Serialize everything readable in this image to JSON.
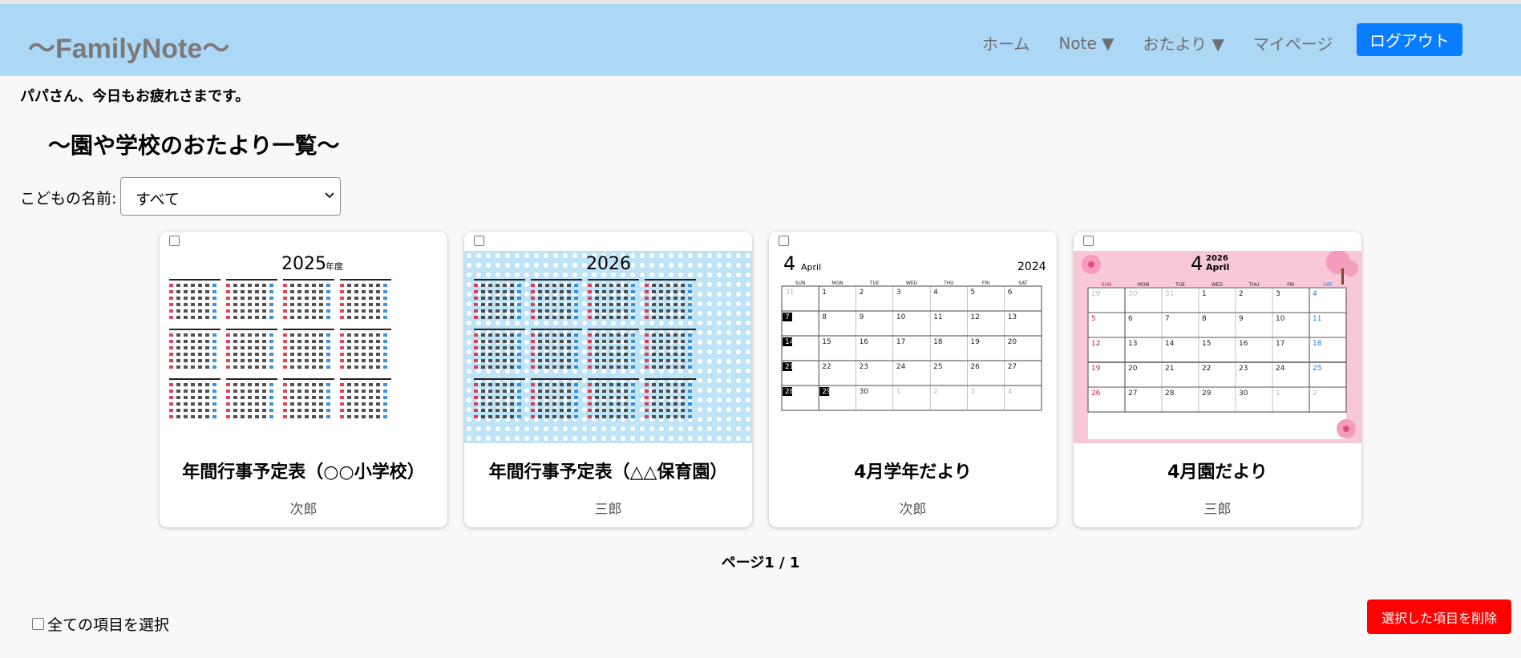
{
  "header": {
    "logo": "〜FamilyNote〜",
    "nav": [
      "ホーム",
      "Note ▼",
      "おたより ▼",
      "マイページ"
    ],
    "logout_label": "ログアウト"
  },
  "greeting": "パパさん、今日もお疲れさまです。",
  "page_title": "〜園や学校のおたより一覧〜",
  "filter": {
    "label": "こどもの名前:",
    "selected": "すべて"
  },
  "cards": [
    {
      "title": "年間行事予定表（○○小学校）",
      "child": "次郎",
      "thumb_heading": "2025",
      "thumb_suffix": "年度"
    },
    {
      "title": "年間行事予定表（△△保育園）",
      "child": "三郎",
      "thumb_heading": "2026"
    },
    {
      "title": "4月学年だより",
      "child": "次郎",
      "month": "4",
      "month_name": "April",
      "year": "2024",
      "weekdays": [
        "SUN",
        "MON",
        "TUE",
        "WED",
        "THU",
        "FRI",
        "SAT"
      ],
      "rows": [
        [
          "31",
          "1",
          "2",
          "3",
          "4",
          "5",
          "6"
        ],
        [
          "7",
          "8",
          "9",
          "10",
          "11",
          "12",
          "13"
        ],
        [
          "14",
          "15",
          "16",
          "17",
          "18",
          "19",
          "20"
        ],
        [
          "21",
          "22",
          "23",
          "24",
          "25",
          "26",
          "27"
        ],
        [
          "28",
          "29",
          "30",
          "1",
          "2",
          "3",
          "4"
        ]
      ]
    },
    {
      "title": "4月園だより",
      "child": "三郎",
      "month": "4",
      "month_name": "April",
      "year": "2026",
      "weekdays": [
        "SUN",
        "MON",
        "TUE",
        "WED",
        "THU",
        "FRI",
        "SAT"
      ],
      "rows": [
        [
          "29",
          "30",
          "31",
          "1",
          "2",
          "3",
          "4"
        ],
        [
          "5",
          "6",
          "7",
          "8",
          "9",
          "10",
          "11"
        ],
        [
          "12",
          "13",
          "14",
          "15",
          "16",
          "17",
          "18"
        ],
        [
          "19",
          "20",
          "21",
          "22",
          "23",
          "24",
          "25"
        ],
        [
          "26",
          "27",
          "28",
          "29",
          "30",
          "1",
          "2"
        ]
      ]
    }
  ],
  "pagination": "ページ1 / 1",
  "select_all_label": "全ての項目を選択",
  "delete_label": "選択した項目を削除",
  "colors": {
    "header_bg": "#acd8f6",
    "logout_bg": "#0a7cff",
    "delete_bg": "#ff0000",
    "holiday_red": "#e0203a",
    "saturday_blue": "#1a7fd6"
  }
}
